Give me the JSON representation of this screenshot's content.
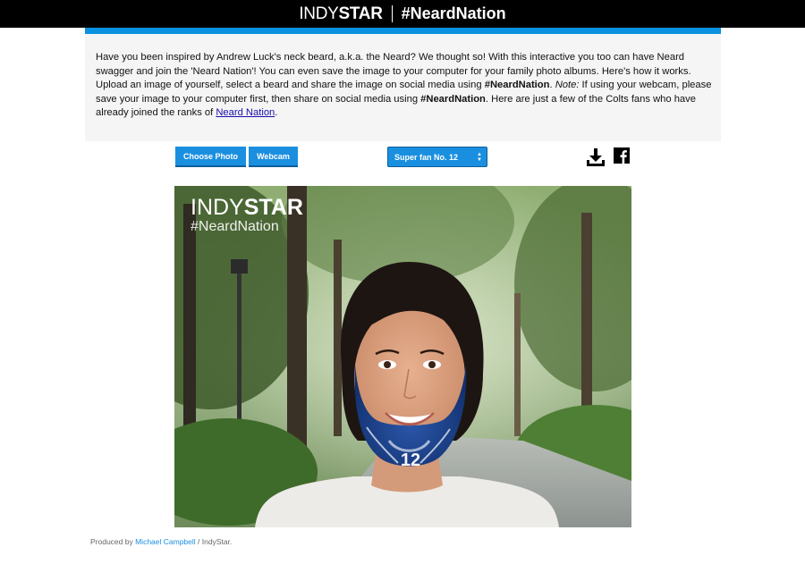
{
  "header": {
    "logo_thin": "INDY",
    "logo_bold": "STAR",
    "hashtag": "#NeardNation"
  },
  "intro": {
    "p1": "Have you been inspired by Andrew Luck's neck beard, a.k.a. the Neard? We thought so! With this interactive you too can have Neard swagger and join the 'Neard Nation'! You can even save the image to your computer for your family photo albums. Here's how it works. Upload an image of yourself, select a beard and share the image on social media using ",
    "hashtag1": "#NeardNation",
    "p2": ". ",
    "note_label": "Note:",
    "p3": " If using your webcam, please save your image to your computer first, then share on social media using ",
    "hashtag2": "#NeardNation",
    "p4": ". Here are just a few of the Colts fans who have already joined the ranks of ",
    "link_text": "Neard Nation",
    "p5": "."
  },
  "controls": {
    "choose_photo": "Choose Photo",
    "webcam": "Webcam",
    "beard_select": "Super fan No. 12"
  },
  "photo": {
    "overlay_logo_thin": "INDY",
    "overlay_logo_bold": "STAR",
    "overlay_tag": "#NeardNation",
    "jersey_number": "12"
  },
  "credit": {
    "prefix": "Produced by ",
    "author": "Michael Campbell",
    "suffix": " / IndyStar."
  },
  "colors": {
    "accent": "#0a91e0",
    "button": "#1a8fe0",
    "beard": "#1c3f8c"
  }
}
